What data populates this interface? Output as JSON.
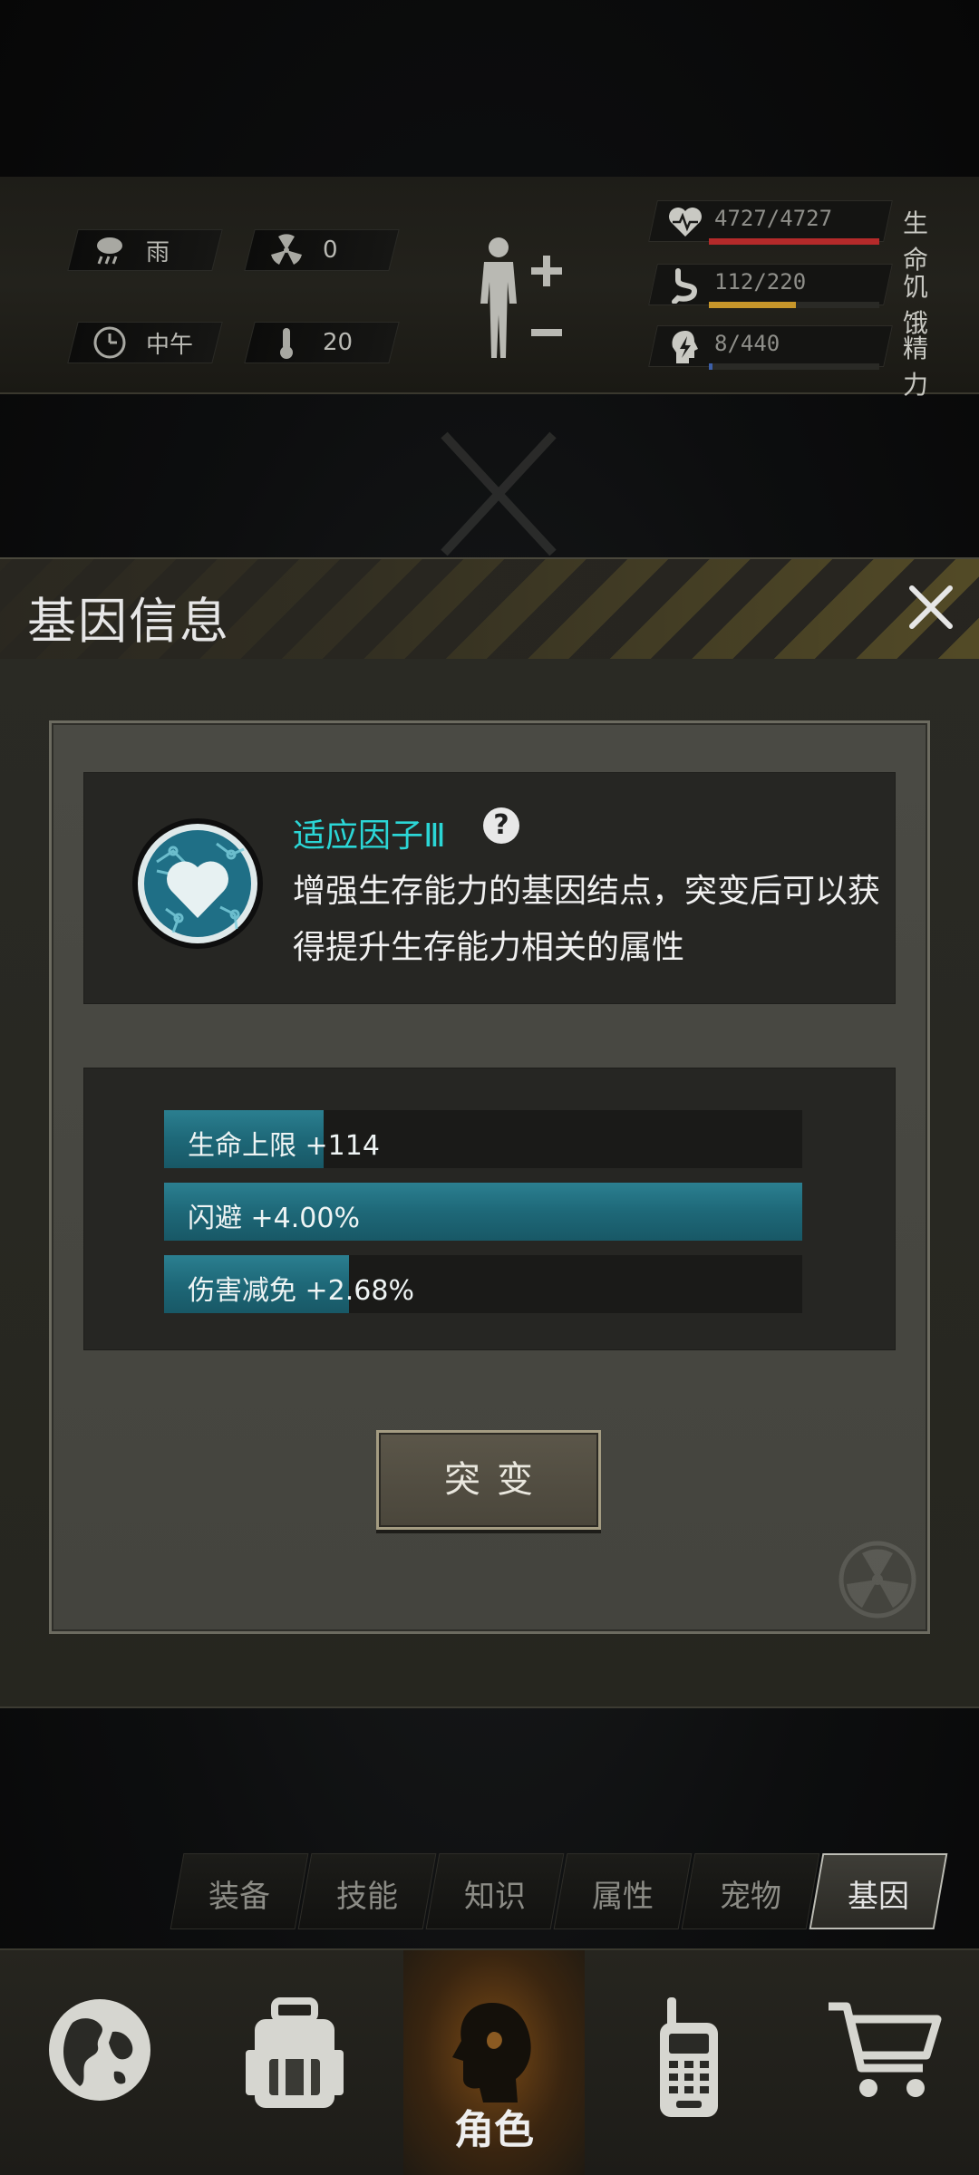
{
  "hud": {
    "weather": "雨",
    "radiation": "0",
    "time_of_day": "中午",
    "temperature": "20",
    "stats": [
      {
        "label": "生命",
        "value": "4727/4727",
        "level": 1.0,
        "color": "#b52a2a"
      },
      {
        "label": "饥饿",
        "value": "112/220",
        "level": 0.51,
        "color": "#c7962a"
      },
      {
        "label": "精力",
        "value": "8/440",
        "level": 0.02,
        "color": "#3c5fa8"
      }
    ]
  },
  "dialog": {
    "title": "基因信息",
    "gene_name": "适应因子Ⅲ",
    "help_glyph": "?",
    "description": "增强生存能力的基因结点，突变后可以获得提升生存能力相关的属性",
    "attributes": [
      {
        "text": "生命上限 +114",
        "level": 0.25
      },
      {
        "text": "闪避 +4.00%",
        "level": 1.0
      },
      {
        "text": "伤害减免 +2.68%",
        "level": 0.29
      }
    ],
    "action_button": "突变"
  },
  "tabs": [
    {
      "label": "装备",
      "active": false
    },
    {
      "label": "技能",
      "active": false
    },
    {
      "label": "知识",
      "active": false
    },
    {
      "label": "属性",
      "active": false
    },
    {
      "label": "宠物",
      "active": false
    },
    {
      "label": "基因",
      "active": true
    }
  ],
  "bottom_nav": {
    "items": [
      "globe-icon",
      "backpack-icon",
      "character-icon",
      "radio-icon",
      "cart-icon"
    ],
    "active_label": "角色"
  }
}
